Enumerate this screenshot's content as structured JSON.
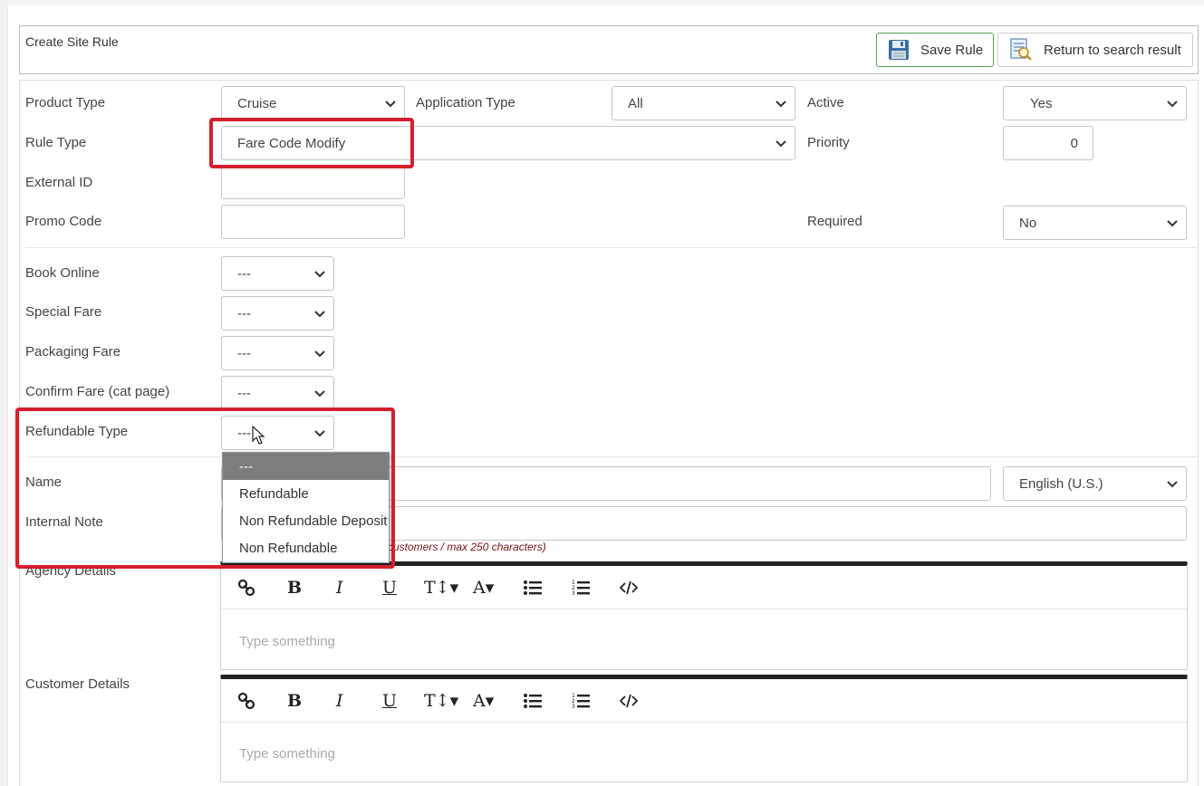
{
  "header": {
    "title": "Create Site Rule",
    "save_label": "Save Rule",
    "return_label": "Return to search result"
  },
  "form": {
    "product_type": {
      "label": "Product Type",
      "value": "Cruise"
    },
    "application_type": {
      "label": "Application Type",
      "value": "All"
    },
    "active": {
      "label": "Active",
      "value": "Yes"
    },
    "rule_type": {
      "label": "Rule Type",
      "value": "Fare Code Modify"
    },
    "priority": {
      "label": "Priority",
      "value": "0"
    },
    "external_id": {
      "label": "External ID",
      "value": ""
    },
    "promo_code": {
      "label": "Promo Code",
      "value": ""
    },
    "required": {
      "label": "Required",
      "value": "No"
    },
    "book_online": {
      "label": "Book Online",
      "value": "---"
    },
    "special_fare": {
      "label": "Special Fare",
      "value": "---"
    },
    "packaging_fare": {
      "label": "Packaging Fare",
      "value": "---"
    },
    "confirm_fare": {
      "label": "Confirm Fare (cat page)",
      "value": "---"
    },
    "refundable_type": {
      "label": "Refundable Type",
      "value": "---",
      "options": [
        "---",
        "Refundable",
        "Non Refundable Deposit",
        "Non Refundable"
      ]
    },
    "name": {
      "label": "Name",
      "language": "English (U.S.)"
    },
    "internal_note": {
      "label": "Internal Note",
      "hint": "customers / max 250 characters)"
    },
    "agency_details": {
      "label": "Agency Details",
      "placeholder": "Type something"
    },
    "customer_details": {
      "label": "Customer Details",
      "placeholder": "Type something"
    }
  },
  "toolbar_icons": [
    "link-icon",
    "bold-icon",
    "italic-icon",
    "underline-icon",
    "text-size-icon",
    "font-color-icon",
    "bullet-list-icon",
    "numbered-list-icon",
    "code-icon"
  ],
  "colors": {
    "highlight": "#d41f2e",
    "save_border": "#5aa05a",
    "editor_top": "#222222",
    "selected_option": "#7d7d7d"
  }
}
